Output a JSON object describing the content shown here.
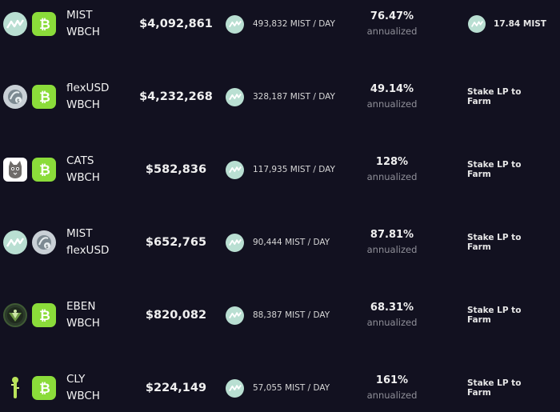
{
  "farms": [
    {
      "token_a": "MIST",
      "token_b": "WBCH",
      "icon_a": "mist-icon",
      "icon_b": "bch-icon",
      "tvl": "$4,092,861",
      "reward": "493,832 MIST / DAY",
      "apr": "76.47%",
      "apr_label": "annualized",
      "action": "17.84 MIST",
      "action_icon": true
    },
    {
      "token_a": "flexUSD",
      "token_b": "WBCH",
      "icon_a": "flexusd-icon",
      "icon_b": "bch-icon",
      "tvl": "$4,232,268",
      "reward": "328,187 MIST / DAY",
      "apr": "49.14%",
      "apr_label": "annualized",
      "action": "Stake LP to Farm",
      "action_icon": false
    },
    {
      "token_a": "CATS",
      "token_b": "WBCH",
      "icon_a": "cats-icon",
      "icon_b": "bch-icon",
      "tvl": "$582,836",
      "reward": "117,935 MIST / DAY",
      "apr": "128%",
      "apr_label": "annualized",
      "action": "Stake LP to Farm",
      "action_icon": false
    },
    {
      "token_a": "MIST",
      "token_b": "flexUSD",
      "icon_a": "mist-icon",
      "icon_b": "flexusd-icon",
      "tvl": "$652,765",
      "reward": "90,444 MIST / DAY",
      "apr": "87.81%",
      "apr_label": "annualized",
      "action": "Stake LP to Farm",
      "action_icon": false
    },
    {
      "token_a": "EBEN",
      "token_b": "WBCH",
      "icon_a": "eben-icon",
      "icon_b": "bch-icon",
      "tvl": "$820,082",
      "reward": "88,387 MIST / DAY",
      "apr": "68.31%",
      "apr_label": "annualized",
      "action": "Stake LP to Farm",
      "action_icon": false
    },
    {
      "token_a": "CLY",
      "token_b": "WBCH",
      "icon_a": "cly-icon",
      "icon_b": "bch-icon",
      "tvl": "$224,149",
      "reward": "57,055 MIST / DAY",
      "apr": "161%",
      "apr_label": "annualized",
      "action": "Stake LP to Farm",
      "action_icon": false
    }
  ]
}
